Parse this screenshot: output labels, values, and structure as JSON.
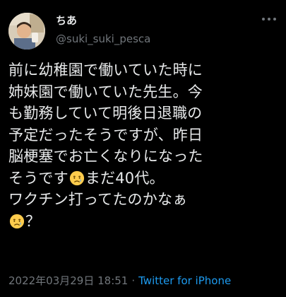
{
  "user": {
    "display_name": "ちあ",
    "handle": "@suki_suki_pesca"
  },
  "more_icon": "more-horizontal-icon",
  "tweet": {
    "line1": "前に幼稚園で働いていた時に",
    "line2": "姉妹園で働いていた先生。今",
    "line3": "も勤務していて明後日退職の",
    "line4": "予定だったそうですが、昨日",
    "line5": "脳梗塞でお亡くなりになった",
    "line6_a": "そうです",
    "line6_b": "まだ40代。",
    "line7": "ワクチン打ってたのかなぁ",
    "line8_b": "？",
    "emoji": "crying-face-icon"
  },
  "meta": {
    "timestamp": "2022年03月29日 18:51",
    "separator": "·",
    "source": "Twitter for iPhone"
  },
  "colors": {
    "background": "#000000",
    "text": "#e7e9ea",
    "secondary": "#71767b",
    "link": "#1d9bf0"
  }
}
